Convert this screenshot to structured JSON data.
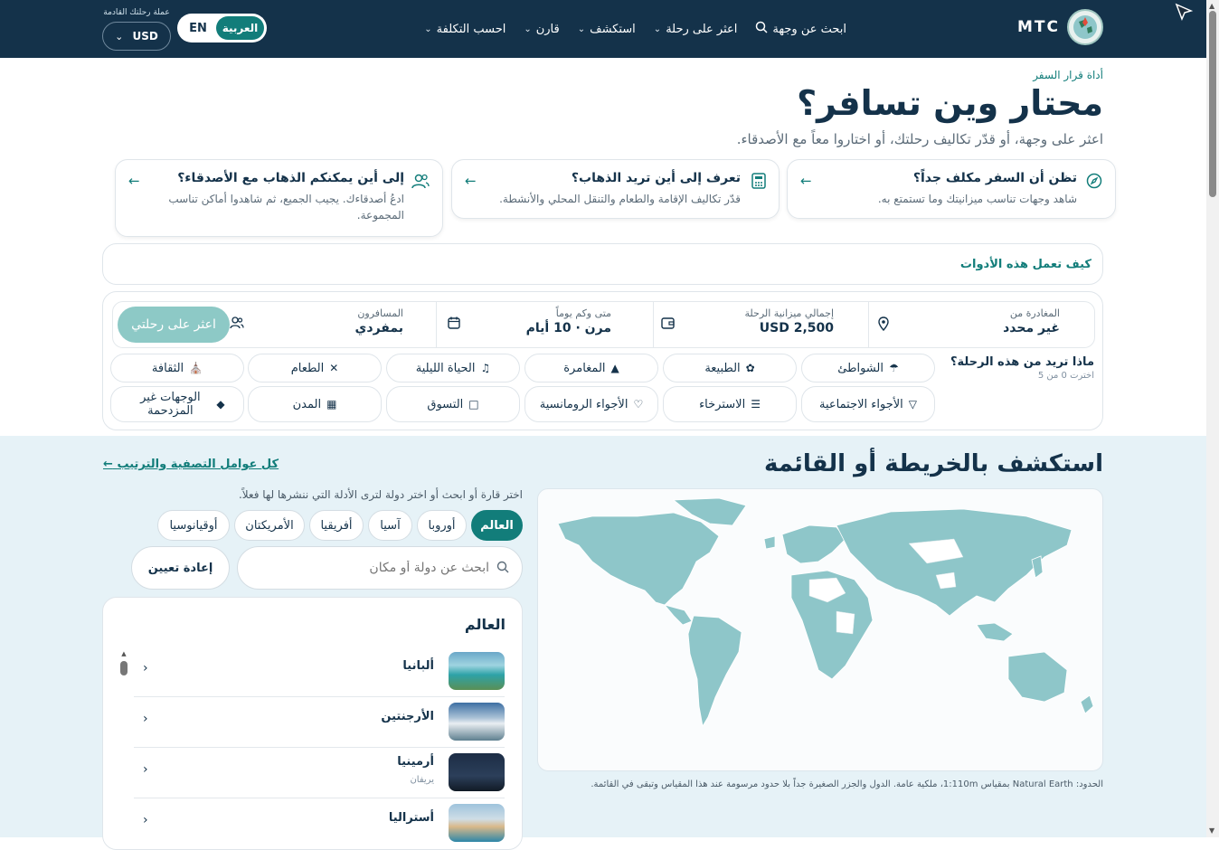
{
  "nav": {
    "brand": "MTC",
    "menu": [
      {
        "label": "ابحث عن وجهة",
        "icon": "search-icon"
      },
      {
        "label": "اعثر على رحلة",
        "icon": "chevron-down-icon"
      },
      {
        "label": "استكشف",
        "icon": "chevron-down-icon"
      },
      {
        "label": "قارن",
        "icon": "chevron-down-icon"
      },
      {
        "label": "احسب التكلفة",
        "icon": "chevron-down-icon"
      }
    ],
    "lang_en": "EN",
    "lang_ar": "العربية",
    "currency_label": "عملة رحلتك القادمة",
    "currency": "USD"
  },
  "header": {
    "crumb": "أداة قرار السفر",
    "title": "محتار وين تسافر؟",
    "subtitle": "اعثر على وجهة، أو قدّر تكاليف رحلتك، أو اختاروا معاً مع الأصدقاء."
  },
  "cards": [
    {
      "title": "تظن أن السفر مكلف جداً؟",
      "desc": "شاهد وجهات تناسب ميزانيتك وما تستمتع به.",
      "icon": "compass-icon"
    },
    {
      "title": "تعرف إلى أين تريد الذهاب؟",
      "desc": "قدّر تكاليف الإقامة والطعام والتنقل المحلي والأنشطة.",
      "icon": "calculator-icon"
    },
    {
      "title": "إلى أين يمكنكم الذهاب مع الأصدقاء؟",
      "desc": "ادعُ أصدقاءك. يجيب الجميع، ثم شاهدوا أماكن تناسب المجموعة.",
      "icon": "users-icon"
    }
  ],
  "how": "كيف تعمل هذه الأدوات",
  "trip": {
    "from_label": "المغادرة من",
    "from_value": "غير محدد",
    "budget_label": "إجمالي ميزانية الرحلة",
    "budget_value": "USD 2,500",
    "when_label": "متى وكم يوماً",
    "when_value": "مرن · 10 أيام",
    "travelers_label": "المسافرون",
    "travelers_value": "بمفردي",
    "find_button": "اعثر على رحلتي",
    "question": "ماذا تريد من هذه الرحلة؟",
    "count": "اخترت 0 من 5"
  },
  "interests": [
    {
      "label": "الشواطئ",
      "icon": "umbrella-icon"
    },
    {
      "label": "الطبيعة",
      "icon": "leaf-icon"
    },
    {
      "label": "المغامرة",
      "icon": "mountain-icon"
    },
    {
      "label": "الحياة الليلية",
      "icon": "music-icon"
    },
    {
      "label": "الطعام",
      "icon": "utensils-icon"
    },
    {
      "label": "الثقافة",
      "icon": "landmark-icon"
    },
    {
      "label": "الأجواء الاجتماعية",
      "icon": "glass-icon"
    },
    {
      "label": "الاسترخاء",
      "icon": "spa-icon"
    },
    {
      "label": "الأجواء الرومانسية",
      "icon": "heart-icon"
    },
    {
      "label": "التسوق",
      "icon": "bag-icon"
    },
    {
      "label": "المدن",
      "icon": "building-icon"
    },
    {
      "label": "الوجهات غير المزدحمة",
      "icon": "gem-icon"
    }
  ],
  "explore": {
    "title": "استكشف بالخريطة أو القائمة",
    "all_filters": "كل عوامل التصفية والترتيب",
    "hint": "اختر قارة أو ابحث أو اختر دولة لترى الأدلة التي ننشرها لها فعلاً.",
    "regions": [
      "العالم",
      "أوروبا",
      "آسيا",
      "أفريقيا",
      "الأمريكتان",
      "أوقيانوسيا"
    ],
    "search_placeholder": "ابحث عن دولة أو مكان",
    "reset": "إعادة تعيين",
    "list_title": "العالم",
    "countries": [
      {
        "name": "ألبانيا",
        "caption": ""
      },
      {
        "name": "الأرجنتين",
        "caption": ""
      },
      {
        "name": "أرمينيا",
        "caption": "يريفان"
      },
      {
        "name": "أستراليا",
        "caption": ""
      }
    ],
    "credit": "الحدود: Natural Earth بمقياس 1:110m، ملكية عامة. الدول والجزر الصغيرة جداً بلا حدود مرسومة عند هذا المقياس وتبقى في القائمة."
  },
  "colors": {
    "navy": "#14324a",
    "teal": "#127d7a",
    "map_land": "#8ec6c9",
    "map_water": "#fafcfd"
  }
}
